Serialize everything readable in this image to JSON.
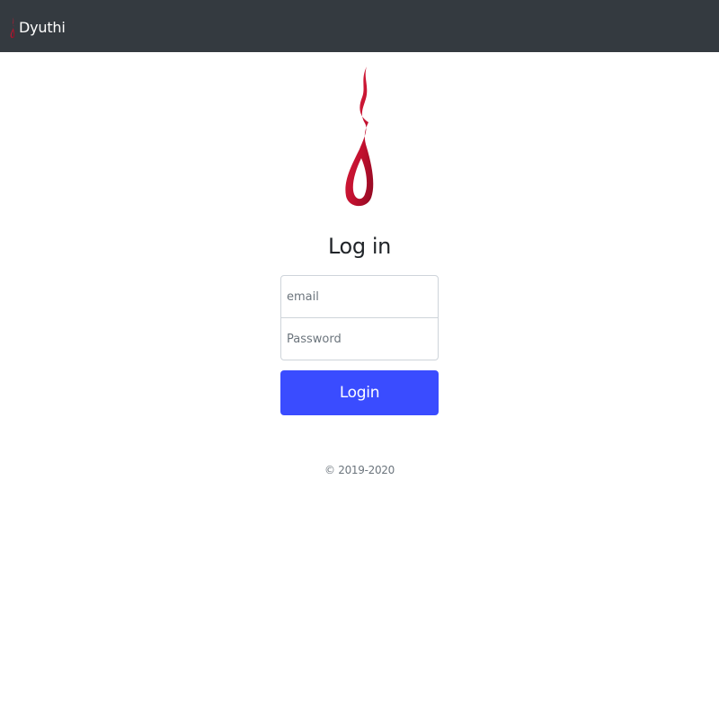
{
  "navbar": {
    "brand_text": "Dyuthi",
    "brand_icon": "flame-logo-icon",
    "background_color": "#343a40"
  },
  "main": {
    "logo_icon": "flame-logo-icon",
    "logo_color": "#c2102f",
    "title": "Log in",
    "email": {
      "placeholder": "email",
      "value": ""
    },
    "password": {
      "placeholder": "Password",
      "value": ""
    },
    "login_label": "Login",
    "login_color": "#3a4cff"
  },
  "footer": {
    "copyright": "© 2019-2020"
  }
}
